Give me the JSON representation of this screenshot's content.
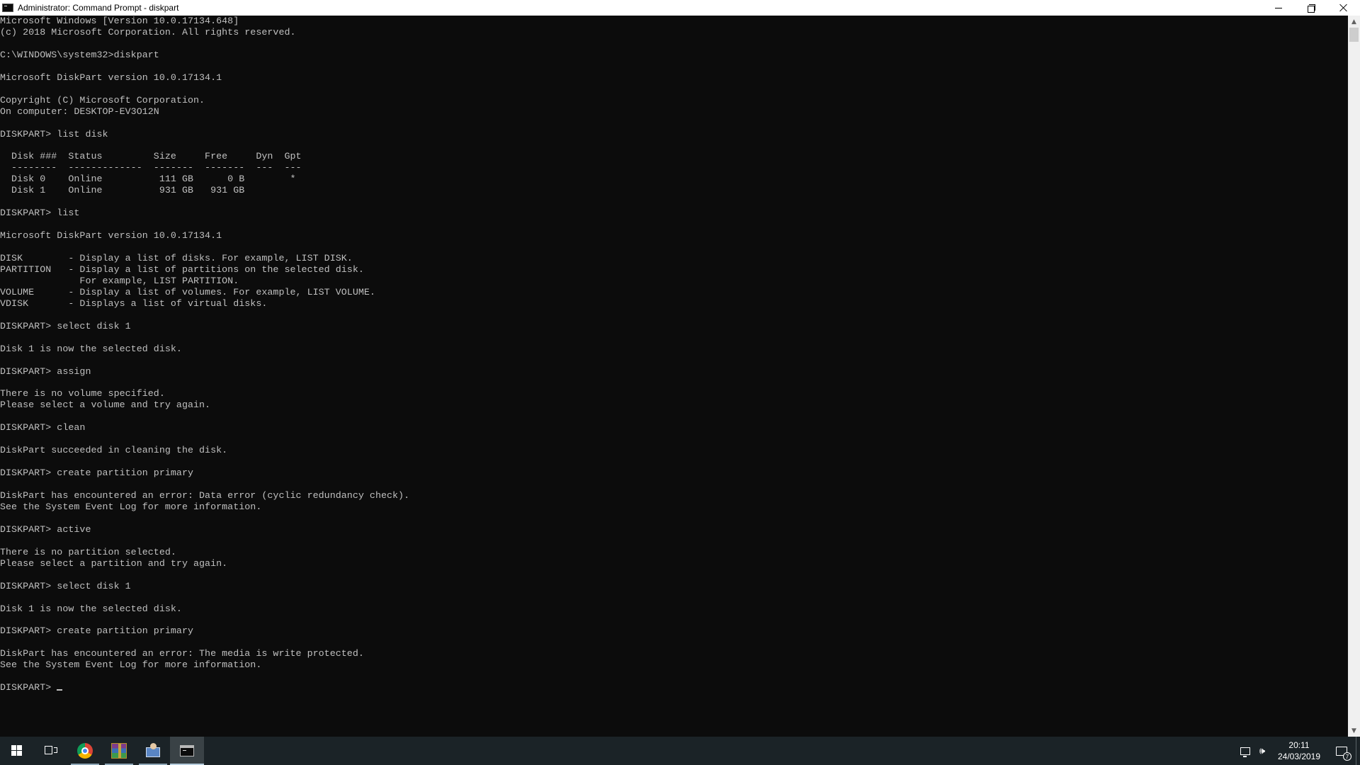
{
  "window": {
    "title": "Administrator: Command Prompt - diskpart"
  },
  "console": {
    "lines": [
      "Microsoft Windows [Version 10.0.17134.648]",
      "(c) 2018 Microsoft Corporation. All rights reserved.",
      "",
      "C:\\WINDOWS\\system32>diskpart",
      "",
      "Microsoft DiskPart version 10.0.17134.1",
      "",
      "Copyright (C) Microsoft Corporation.",
      "On computer: DESKTOP-EV3O12N",
      "",
      "DISKPART> list disk",
      "",
      "  Disk ###  Status         Size     Free     Dyn  Gpt",
      "  --------  -------------  -------  -------  ---  ---",
      "  Disk 0    Online          111 GB      0 B        *",
      "  Disk 1    Online          931 GB   931 GB",
      "",
      "DISKPART> list",
      "",
      "Microsoft DiskPart version 10.0.17134.1",
      "",
      "DISK        - Display a list of disks. For example, LIST DISK.",
      "PARTITION   - Display a list of partitions on the selected disk.",
      "              For example, LIST PARTITION.",
      "VOLUME      - Display a list of volumes. For example, LIST VOLUME.",
      "VDISK       - Displays a list of virtual disks.",
      "",
      "DISKPART> select disk 1",
      "",
      "Disk 1 is now the selected disk.",
      "",
      "DISKPART> assign",
      "",
      "There is no volume specified.",
      "Please select a volume and try again.",
      "",
      "DISKPART> clean",
      "",
      "DiskPart succeeded in cleaning the disk.",
      "",
      "DISKPART> create partition primary",
      "",
      "DiskPart has encountered an error: Data error (cyclic redundancy check).",
      "See the System Event Log for more information.",
      "",
      "DISKPART> active",
      "",
      "There is no partition selected.",
      "Please select a partition and try again.",
      "",
      "DISKPART> select disk 1",
      "",
      "Disk 1 is now the selected disk.",
      "",
      "DISKPART> create partition primary",
      "",
      "DiskPart has encountered an error: The media is write protected.",
      "See the System Event Log for more information.",
      ""
    ],
    "prompt": "DISKPART> "
  },
  "taskbar": {
    "apps": [
      {
        "name": "chrome",
        "icon": "chrome-icon"
      },
      {
        "name": "winrar",
        "icon": "winrar-icon"
      },
      {
        "name": "user-accounts",
        "icon": "user-icon"
      },
      {
        "name": "command-prompt",
        "icon": "cmd-icon"
      }
    ],
    "clock": {
      "time": "20:11",
      "date": "24/03/2019"
    },
    "notification_count": "7",
    "volume_glyph": "🕪"
  },
  "colors": {
    "console_bg": "#0c0c0c",
    "console_fg": "#c0c0c0",
    "taskbar_bg": "#1b2327"
  }
}
